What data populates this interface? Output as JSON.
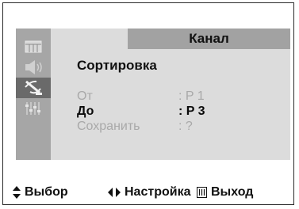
{
  "header": {
    "title": "Канал"
  },
  "menu": {
    "section_title": "Сортировка",
    "rows": [
      {
        "label": "От",
        "value": ":  P  1",
        "state": "dim"
      },
      {
        "label": "До",
        "value": ":  P  3",
        "state": "bold"
      },
      {
        "label": "Сохранить",
        "value": ":   ?",
        "state": "dim"
      }
    ]
  },
  "side_icons": [
    {
      "name": "picture-icon",
      "active": false
    },
    {
      "name": "sound-icon",
      "active": false
    },
    {
      "name": "channel-antenna-icon",
      "active": true
    },
    {
      "name": "setup-equalizer-icon",
      "active": false
    }
  ],
  "footer": {
    "select_label": "Выбор",
    "adjust_label": "Настройка",
    "exit_label": "Выход"
  },
  "colors": {
    "background": "#ffffff",
    "screen": "#d6d6d6",
    "icon_column": "#a6a6a6",
    "header_bar": "#a2a2a2",
    "dim_text": "#a9a9a9",
    "text": "#111111"
  }
}
